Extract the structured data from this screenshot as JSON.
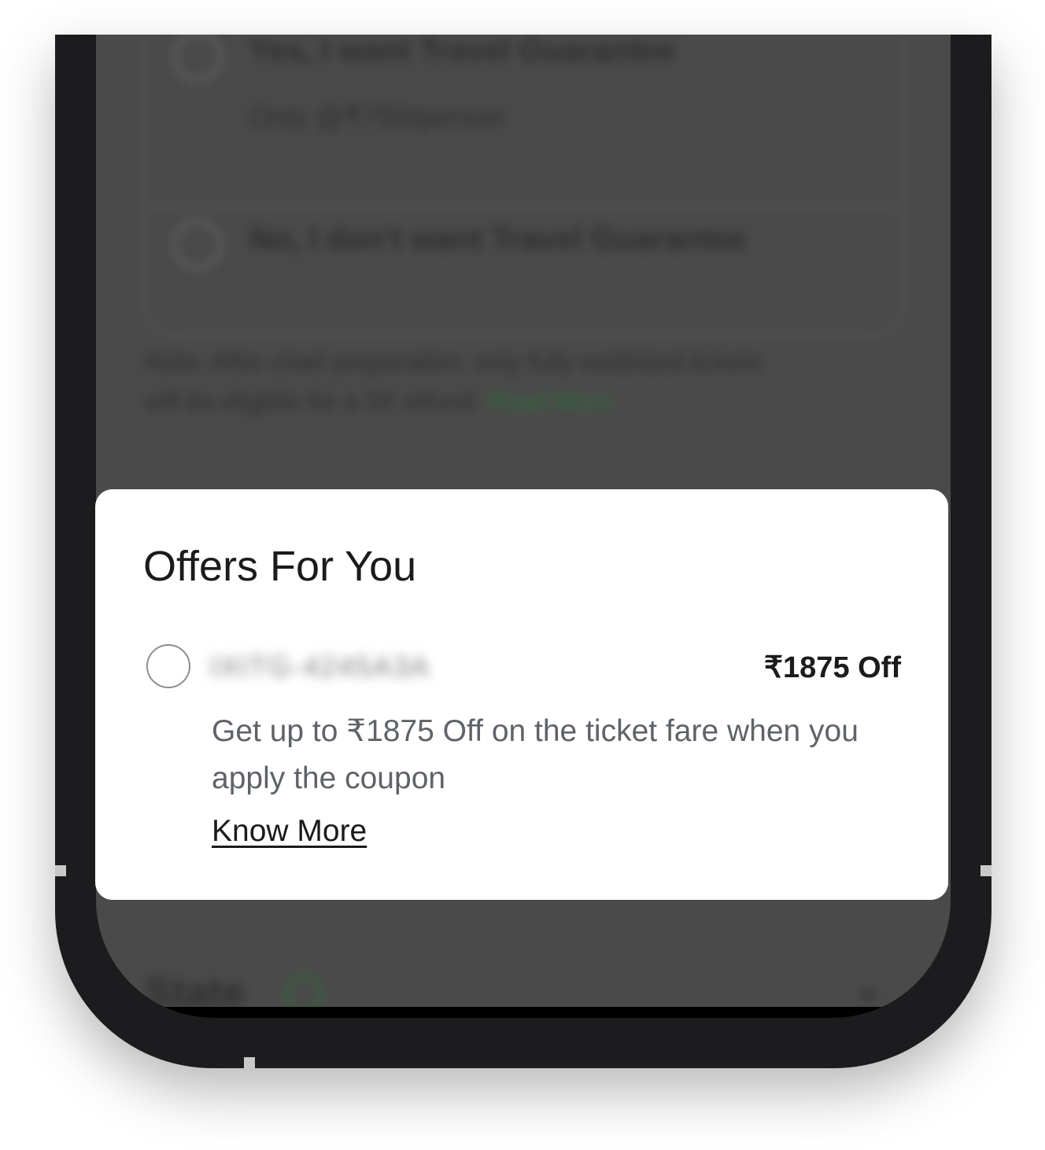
{
  "background": {
    "yes_option": "Yes, I want Travel Guarantee",
    "yes_price": "Only @₹750/person",
    "no_option": "No, I don't want Travel Guarantee",
    "note_line1": "Note: After chart preparation, only fully waitlisted tickets",
    "note_line2": "will be eligible for a 3X refund.",
    "note_link": "Read More",
    "state_label": "State"
  },
  "offers": {
    "title": "Offers For You",
    "coupon_code": "IXITG-4245A3A",
    "discount": "₹1875 Off",
    "description": "Get up to ₹1875 Off on the ticket fare when you apply the coupon",
    "know_more": "Know More"
  },
  "colors": {
    "overlay": "#4a4a4a",
    "sheet": "#ffffff",
    "link_green": "#2e6b3a"
  },
  "icons": {
    "coupon_radio": "radio-unchecked-icon",
    "state_info": "info-circle-icon",
    "state_expand": "chevron-down-icon"
  }
}
